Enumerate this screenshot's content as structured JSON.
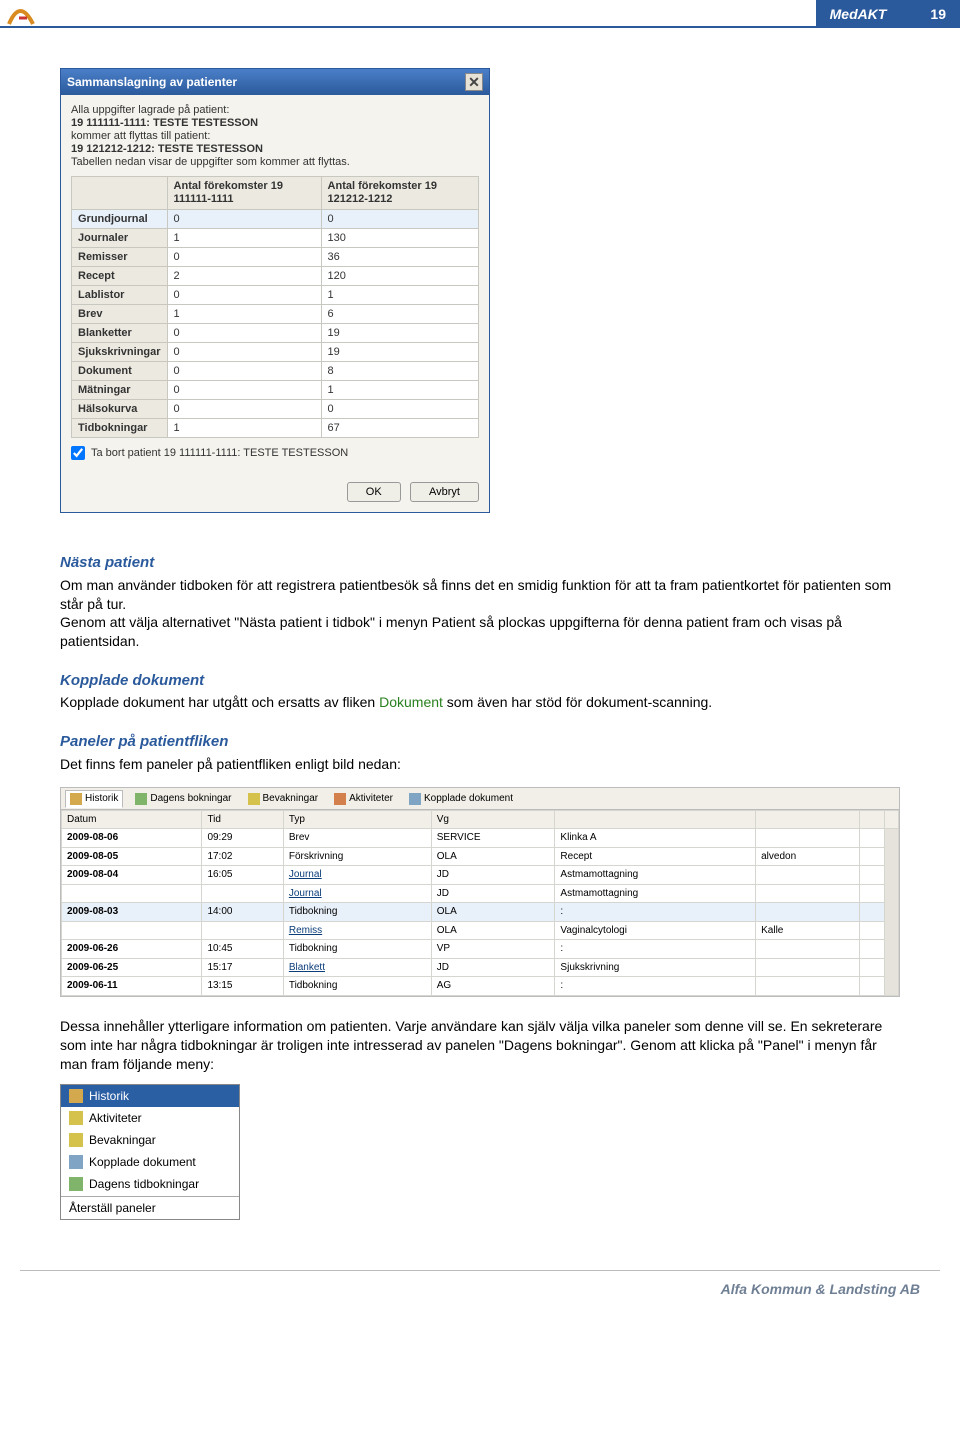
{
  "header": {
    "brand": "MedAKT",
    "page_num": "19"
  },
  "dlg1": {
    "title": "Sammanslagning av patienter",
    "intro": {
      "line1": "Alla uppgifter lagrade på patient:",
      "pat1": "19 111111-1111: TESTE TESTESSON",
      "line2": "kommer att flyttas till patient:",
      "pat2": "19 121212-1212: TESTE TESTESSON",
      "line3": "Tabellen nedan visar de uppgifter som kommer att flyttas."
    },
    "cols": [
      "",
      "Antal förekomster 19 111111-1111",
      "Antal förekomster 19 121212-1212"
    ],
    "rows": [
      {
        "name": "Grundjournal",
        "a": "0",
        "b": "0"
      },
      {
        "name": "Journaler",
        "a": "1",
        "b": "130"
      },
      {
        "name": "Remisser",
        "a": "0",
        "b": "36"
      },
      {
        "name": "Recept",
        "a": "2",
        "b": "120"
      },
      {
        "name": "Lablistor",
        "a": "0",
        "b": "1"
      },
      {
        "name": "Brev",
        "a": "1",
        "b": "6"
      },
      {
        "name": "Blanketter",
        "a": "0",
        "b": "19"
      },
      {
        "name": "Sjukskrivningar",
        "a": "0",
        "b": "19"
      },
      {
        "name": "Dokument",
        "a": "0",
        "b": "8"
      },
      {
        "name": "Mätningar",
        "a": "0",
        "b": "1"
      },
      {
        "name": "Hälsokurva",
        "a": "0",
        "b": "0"
      },
      {
        "name": "Tidbokningar",
        "a": "1",
        "b": "67"
      }
    ],
    "checkbox_label": "Ta bort patient 19 111111-1111: TESTE TESTESSON",
    "ok": "OK",
    "cancel": "Avbryt"
  },
  "sections": {
    "nasta_h": "Nästa patient",
    "nasta_p1": "Om man använder tidboken för att registrera patientbesök så finns det en smidig funktion för att ta fram patientkortet för patienten som står på tur.",
    "nasta_p2a": "Genom att välja alternativet \"Nästa patient i tidbok\" i menyn ",
    "nasta_p2b": "Patient",
    "nasta_p2c": " så plockas uppgifterna för denna patient fram och visas på patientsidan.",
    "kopplade_h": "Kopplade dokument",
    "kopplade_a": "Kopplade dokument har utgått och ersatts av fliken ",
    "kopplade_link": "Dokument",
    "kopplade_b": " som även har stöd för dokument-scanning.",
    "paneler_h": "Paneler på patientfliken",
    "paneler_p": "Det finns fem paneler på patientfliken enligt bild nedan:",
    "after_p": "Dessa innehåller ytterligare information om patienten. Varje användare kan själv välja vilka paneler som denne vill se. En sekreterare som inte har några tidbokningar är troligen inte intresserad av panelen \"Dagens bokningar\". Genom att klicka på \"Panel\" i menyn får man fram följande meny:"
  },
  "hist_tabs": [
    "Historik",
    "Dagens bokningar",
    "Bevakningar",
    "Aktiviteter",
    "Kopplade dokument"
  ],
  "hist_cols": [
    "Datum",
    "Tid",
    "Typ",
    "Vg",
    "",
    "",
    ""
  ],
  "hist_rows": [
    {
      "d": "2009-08-06",
      "t": "09:29",
      "typ": "Brev",
      "vg": "SERVICE",
      "c5": "Klinka A",
      "c6": "",
      "link": false,
      "hl": false
    },
    {
      "d": "2009-08-05",
      "t": "17:02",
      "typ": "Förskrivning",
      "vg": "OLA",
      "c5": "Recept",
      "c6": "alvedon",
      "link": false,
      "hl": false
    },
    {
      "d": "2009-08-04",
      "t": "16:05",
      "typ": "Journal",
      "vg": "JD",
      "c5": "Astmamottagning",
      "c6": "",
      "link": true,
      "hl": false
    },
    {
      "d": "",
      "t": "",
      "typ": "Journal",
      "vg": "JD",
      "c5": "Astmamottagning",
      "c6": "",
      "link": true,
      "hl": false
    },
    {
      "d": "2009-08-03",
      "t": "14:00",
      "typ": "Tidbokning",
      "vg": "OLA",
      "c5": ":",
      "c6": "",
      "link": false,
      "hl": true
    },
    {
      "d": "",
      "t": "",
      "typ": "Remiss",
      "vg": "OLA",
      "c5": "Vaginalcytologi",
      "c6": "Kalle",
      "link": true,
      "hl": false
    },
    {
      "d": "2009-06-26",
      "t": "10:45",
      "typ": "Tidbokning",
      "vg": "VP",
      "c5": ":",
      "c6": "",
      "link": false,
      "hl": false
    },
    {
      "d": "2009-06-25",
      "t": "15:17",
      "typ": "Blankett",
      "vg": "JD",
      "c5": "Sjukskrivning",
      "c6": "",
      "link": true,
      "hl": false
    },
    {
      "d": "2009-06-11",
      "t": "13:15",
      "typ": "Tidbokning",
      "vg": "AG",
      "c5": ":",
      "c6": "",
      "link": false,
      "hl": false
    }
  ],
  "panel_menu": {
    "items": [
      "Historik",
      "Aktiviteter",
      "Bevakningar",
      "Kopplade dokument",
      "Dagens tidbokningar"
    ],
    "reset": "Återställ paneler"
  },
  "footer": "Alfa Kommun & Landsting AB"
}
